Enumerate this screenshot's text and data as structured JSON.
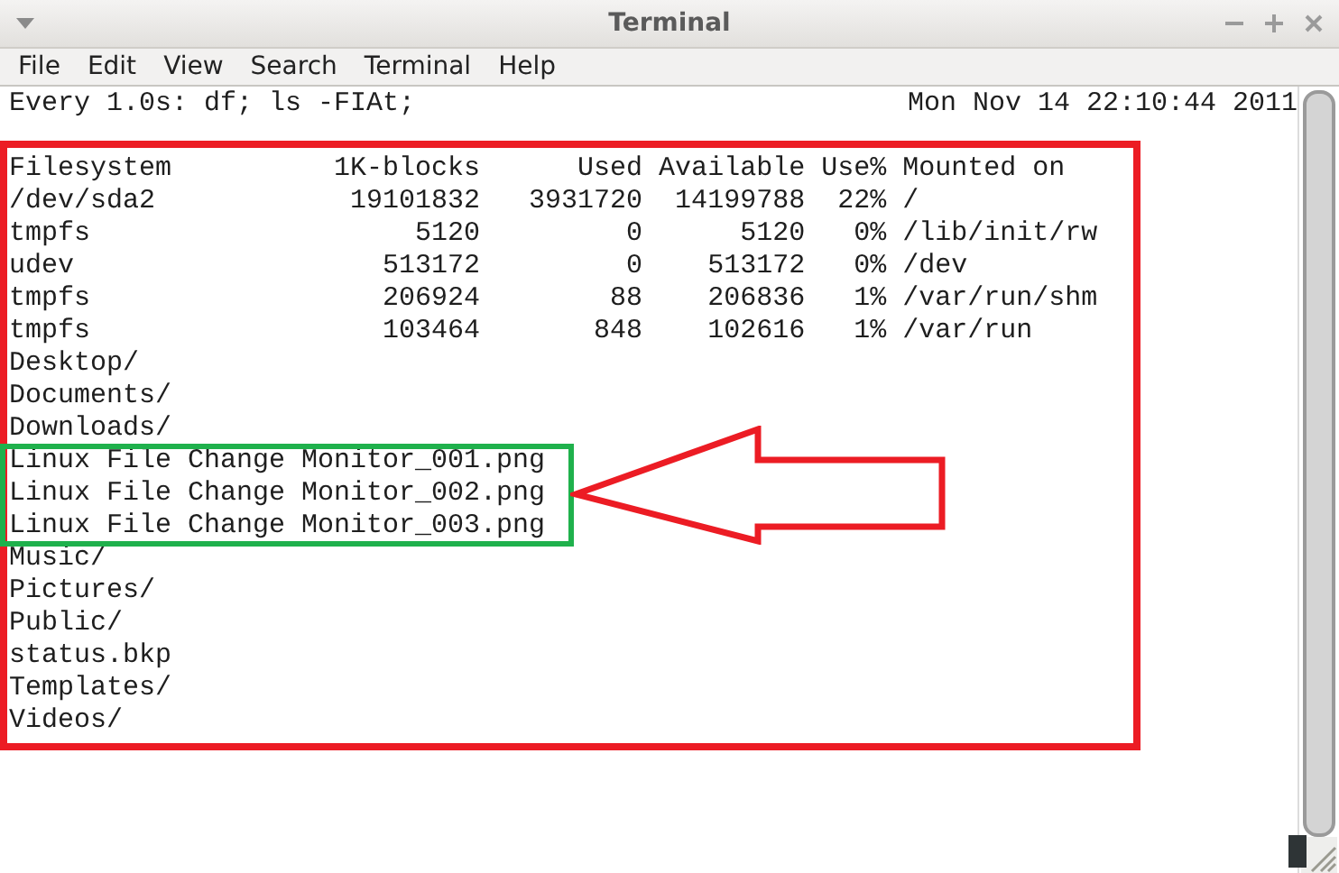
{
  "window": {
    "title": "Terminal"
  },
  "menu": [
    "File",
    "Edit",
    "View",
    "Search",
    "Terminal",
    "Help"
  ],
  "watch_header": {
    "command": "Every 1.0s: df; ls -FIAt;",
    "time": "Mon Nov 14 22:10:44 2011"
  },
  "lines": [
    "Filesystem          1K-blocks      Used Available Use% Mounted on",
    "/dev/sda2            19101832   3931720  14199788  22% /",
    "tmpfs                    5120         0      5120   0% /lib/init/rw",
    "udev                   513172         0    513172   0% /dev",
    "tmpfs                  206924        88    206836   1% /var/run/shm",
    "tmpfs                  103464       848    102616   1% /var/run",
    "Desktop/",
    "Documents/",
    "Downloads/",
    "Linux File Change Monitor_001.png",
    "Linux File Change Monitor_002.png",
    "Linux File Change Monitor_003.png",
    "Music/",
    "Pictures/",
    "Public/",
    "status.bkp",
    "Templates/",
    "Videos/"
  ]
}
